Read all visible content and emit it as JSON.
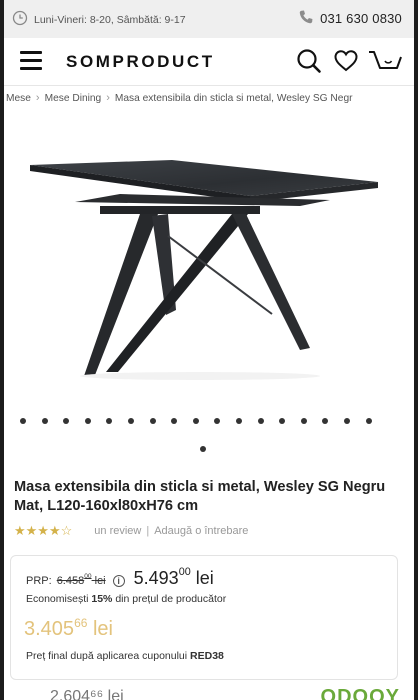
{
  "topbar": {
    "hours": "Luni-Vineri: 8-20, Sâmbătă: 9-17",
    "phone": "031 630 0830"
  },
  "header": {
    "logo": "SOMPRODUCT",
    "icons": [
      "menu-icon",
      "search-icon",
      "heart-icon",
      "cart-icon"
    ]
  },
  "breadcrumb": {
    "items": [
      "Mese",
      "Mese Dining",
      "Masa extensibila din sticla si metal, Wesley SG Negr"
    ]
  },
  "carousel": {
    "dot_count": 18
  },
  "product": {
    "title": "Masa extensibila din sticla si metal, Wesley SG Negru Mat, L120-160xl80xH76 cm",
    "stars_glyphs": "★★★★☆",
    "review_link": "un review",
    "divider": "|",
    "question_link": "Adaugă o întrebare"
  },
  "pricing": {
    "prp_label": "PRP:",
    "prp_old_int": "6.458",
    "prp_old_dec": "00",
    "prp_old_currency": "lei",
    "info_glyph": "i",
    "current_int": "5.493",
    "current_dec": "00",
    "current_currency": "lei",
    "savings_prefix": "Economisești",
    "savings_percent": "15%",
    "savings_suffix": "din prețul de producător",
    "coupon_int": "3.405",
    "coupon_dec": "66",
    "coupon_currency": "lei",
    "coupon_note_prefix": "Preț final după aplicarea cuponului",
    "coupon_code": "RED38"
  },
  "bottom": {
    "price_partial": "2.604⁶⁶ lei",
    "brand_partial": "ODOOY"
  },
  "colors": {
    "coupon_gold": "#e3c37c",
    "star_gold": "#d4b24a",
    "topbar_bg": "#efefef"
  }
}
